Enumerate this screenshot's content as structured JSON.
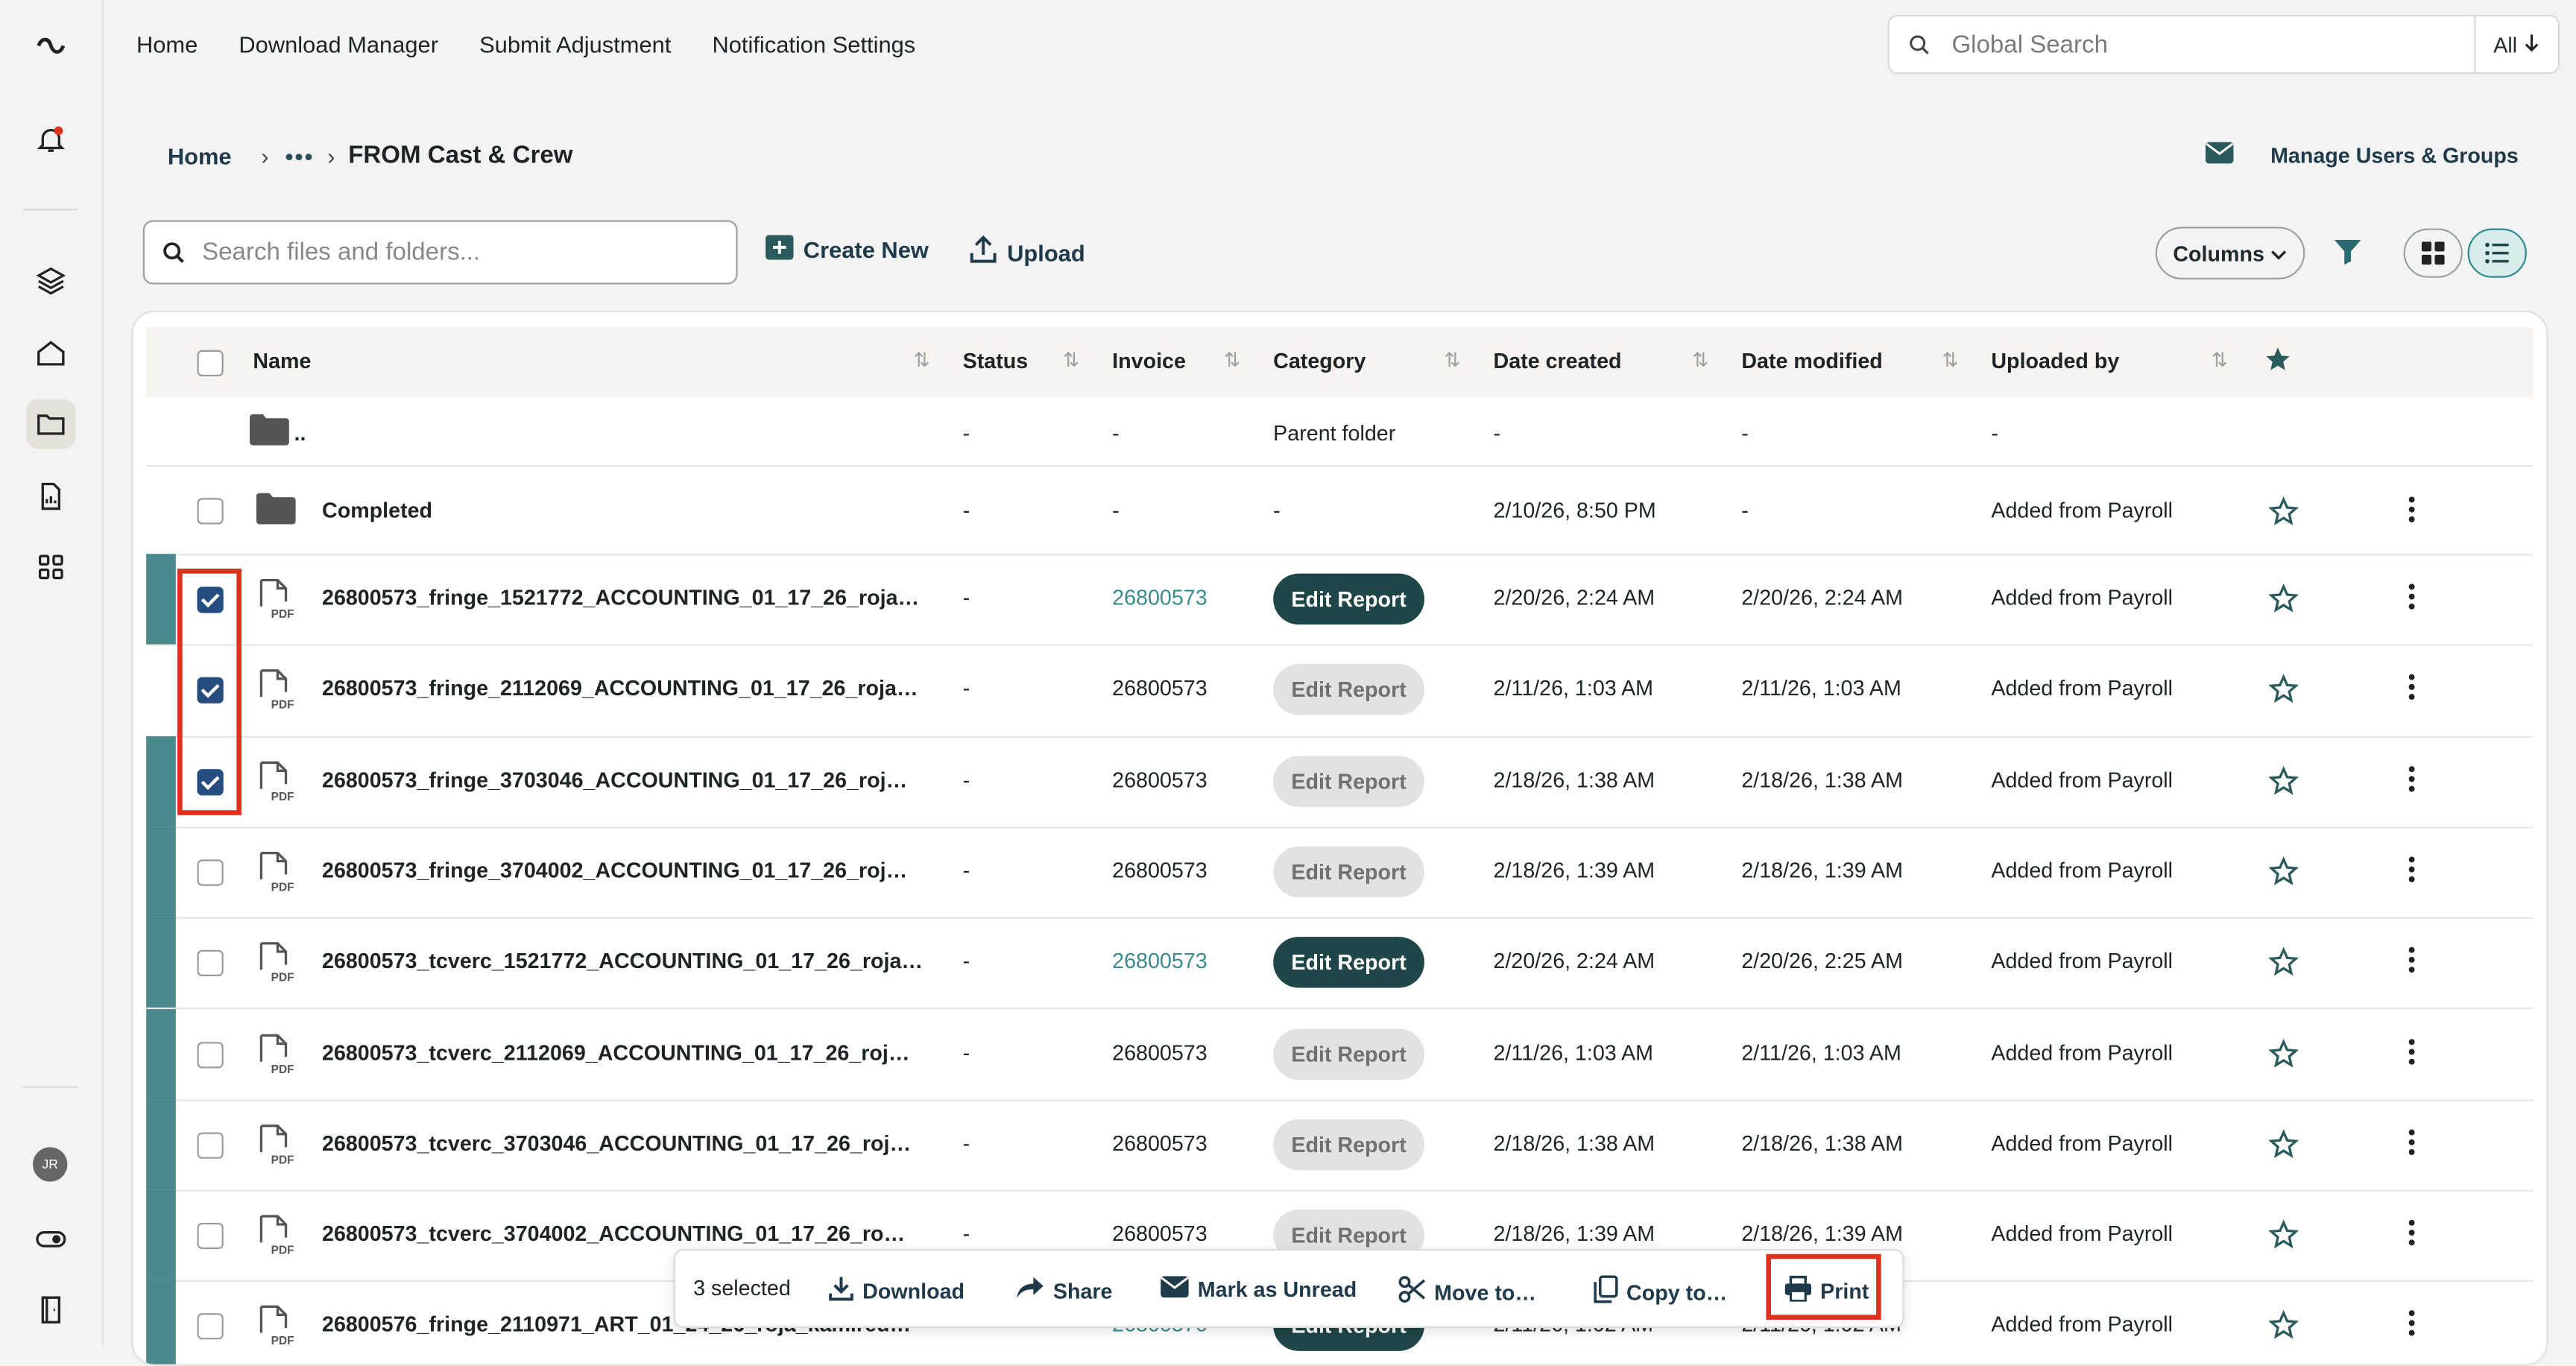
{
  "nav": {
    "items": [
      "Home",
      "Download Manager",
      "Submit Adjustment",
      "Notification Settings"
    ],
    "search_placeholder": "Global Search",
    "search_scope": "All"
  },
  "breadcrumb": {
    "home": "Home",
    "more": "•••",
    "current": "FROM Cast & Crew"
  },
  "manage_label": "Manage Users & Groups",
  "user_initials": "JR",
  "toolbar": {
    "search_placeholder": "Search files and folders...",
    "create_new": "Create New",
    "upload": "Upload",
    "columns": "Columns"
  },
  "table": {
    "columns": [
      "Name",
      "Status",
      "Invoice",
      "Category",
      "Date created",
      "Date modified",
      "Uploaded by"
    ],
    "parent_row": {
      "name": "..",
      "status": "-",
      "invoice": "-",
      "category": "Parent folder",
      "created": "-",
      "modified": "-",
      "uploaded_by": "-"
    },
    "folder_row": {
      "name": "Completed",
      "status": "-",
      "invoice": "-",
      "category": "-",
      "created": "2/10/26, 8:50 PM",
      "modified": "-",
      "uploaded_by": "Added from Payroll"
    },
    "files": [
      {
        "name": "26800573_fringe_1521772_ACCOUNTING_01_17_26_roja…",
        "status": "-",
        "invoice": "26800573",
        "invoice_link": true,
        "report": "Edit Report",
        "report_style": "dark",
        "created": "2/20/26, 2:24 AM",
        "modified": "2/20/26, 2:24 AM",
        "uploaded_by": "Added from Payroll",
        "checked": true,
        "bar": true
      },
      {
        "name": "26800573_fringe_2112069_ACCOUNTING_01_17_26_roja…",
        "status": "-",
        "invoice": "26800573",
        "invoice_link": false,
        "report": "Edit Report",
        "report_style": "light",
        "created": "2/11/26, 1:03 AM",
        "modified": "2/11/26, 1:03 AM",
        "uploaded_by": "Added from Payroll",
        "checked": true,
        "bar": false
      },
      {
        "name": "26800573_fringe_3703046_ACCOUNTING_01_17_26_roj…",
        "status": "-",
        "invoice": "26800573",
        "invoice_link": false,
        "report": "Edit Report",
        "report_style": "light",
        "created": "2/18/26, 1:38 AM",
        "modified": "2/18/26, 1:38 AM",
        "uploaded_by": "Added from Payroll",
        "checked": true,
        "bar": true
      },
      {
        "name": "26800573_fringe_3704002_ACCOUNTING_01_17_26_roj…",
        "status": "-",
        "invoice": "26800573",
        "invoice_link": false,
        "report": "Edit Report",
        "report_style": "light",
        "created": "2/18/26, 1:39 AM",
        "modified": "2/18/26, 1:39 AM",
        "uploaded_by": "Added from Payroll",
        "checked": false,
        "bar": true
      },
      {
        "name": "26800573_tcverc_1521772_ACCOUNTING_01_17_26_roja…",
        "status": "-",
        "invoice": "26800573",
        "invoice_link": true,
        "report": "Edit Report",
        "report_style": "dark",
        "created": "2/20/26, 2:24 AM",
        "modified": "2/20/26, 2:25 AM",
        "uploaded_by": "Added from Payroll",
        "checked": false,
        "bar": true
      },
      {
        "name": "26800573_tcverc_2112069_ACCOUNTING_01_17_26_roj…",
        "status": "-",
        "invoice": "26800573",
        "invoice_link": false,
        "report": "Edit Report",
        "report_style": "light",
        "created": "2/11/26, 1:03 AM",
        "modified": "2/11/26, 1:03 AM",
        "uploaded_by": "Added from Payroll",
        "checked": false,
        "bar": true
      },
      {
        "name": "26800573_tcverc_3703046_ACCOUNTING_01_17_26_roj…",
        "status": "-",
        "invoice": "26800573",
        "invoice_link": false,
        "report": "Edit Report",
        "report_style": "light",
        "created": "2/18/26, 1:38 AM",
        "modified": "2/18/26, 1:38 AM",
        "uploaded_by": "Added from Payroll",
        "checked": false,
        "bar": true
      },
      {
        "name": "26800573_tcverc_3704002_ACCOUNTING_01_17_26_ro…",
        "status": "-",
        "invoice": "26800573",
        "invoice_link": false,
        "report": "Edit Report",
        "report_style": "light",
        "created": "2/18/26, 1:39 AM",
        "modified": "2/18/26, 1:39 AM",
        "uploaded_by": "Added from Payroll",
        "checked": false,
        "bar": true
      },
      {
        "name": "26800576_fringe_2110971_ART_01_24_26_roja_kamired…",
        "status": "-",
        "invoice": "26800576",
        "invoice_link": true,
        "report": "Edit Report",
        "report_style": "dark",
        "created": "2/11/26, 1:02 AM",
        "modified": "2/11/26, 1:02 AM",
        "uploaded_by": "Added from Payroll",
        "checked": false,
        "bar": true
      }
    ]
  },
  "actionbar": {
    "count": "3 selected",
    "download": "Download",
    "share": "Share",
    "mark_unread": "Mark as Unread",
    "move": "Move to…",
    "copy": "Copy to…",
    "print": "Print"
  },
  "colors": {
    "accent": "#1f4648",
    "teal_bar": "#4b8a8c",
    "checkbox": "#254d80",
    "highlight": "#e0301e"
  }
}
